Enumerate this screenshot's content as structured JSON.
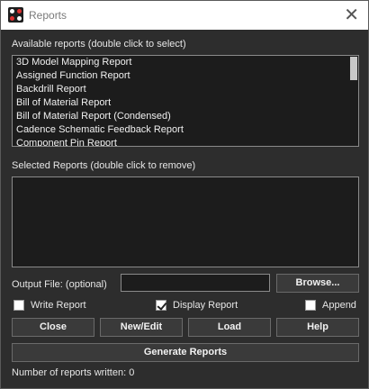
{
  "window": {
    "title": "Reports"
  },
  "available": {
    "label": "Available reports (double click to select)",
    "items": [
      "3D Model Mapping Report",
      "Assigned Function Report",
      "Backdrill Report",
      "Bill of Material Report",
      "Bill of Material Report (Condensed)",
      "Cadence Schematic Feedback Report",
      "Component Pin Report"
    ]
  },
  "selected": {
    "label": "Selected Reports (double click to remove)",
    "items": []
  },
  "output": {
    "label": "Output File: (optional)",
    "value": "",
    "browse_label": "Browse..."
  },
  "options": {
    "write_report": {
      "label": "Write Report",
      "checked": false
    },
    "display_report": {
      "label": "Display Report",
      "checked": true
    },
    "append": {
      "label": "Append",
      "checked": false
    }
  },
  "buttons": {
    "close": "Close",
    "new_edit": "New/Edit",
    "load": "Load",
    "help": "Help",
    "generate": "Generate Reports"
  },
  "status": {
    "text": "Number of reports written: 0"
  }
}
